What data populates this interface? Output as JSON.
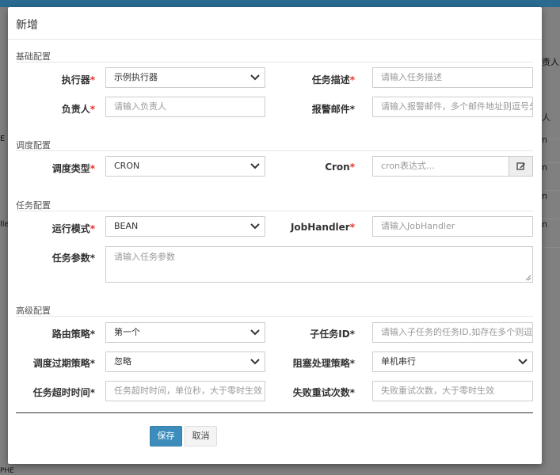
{
  "background": {
    "rows": [
      "人",
      "n",
      "n",
      "n",
      "n"
    ],
    "left_texts": [
      "E",
      "lle"
    ],
    "right_partial": "责人",
    "bottom_text": "PHE"
  },
  "modal": {
    "title": "新增",
    "sections": {
      "basic": "基础配置",
      "schedule": "调度配置",
      "task": "任务配置",
      "advanced": "高级配置"
    },
    "fields": {
      "executor": {
        "label": "执行器",
        "value": "示例执行器"
      },
      "task_desc": {
        "label": "任务描述",
        "placeholder": "请输入任务描述"
      },
      "owner": {
        "label": "负责人",
        "placeholder": "请输入负责人"
      },
      "alarm_email": {
        "label": "报警邮件",
        "placeholder": "请输入报警邮件，多个邮件地址则逗号分隔"
      },
      "schedule_type": {
        "label": "调度类型",
        "value": "CRON"
      },
      "cron": {
        "label": "Cron",
        "placeholder": "cron表达式..."
      },
      "run_mode": {
        "label": "运行模式",
        "value": "BEAN"
      },
      "job_handler": {
        "label": "JobHandler",
        "placeholder": "请输入JobHandler"
      },
      "task_param": {
        "label": "任务参数",
        "placeholder": "请输入任务参数"
      },
      "route_strategy": {
        "label": "路由策略",
        "value": "第一个"
      },
      "child_job": {
        "label": "子任务ID",
        "placeholder": "请输入子任务的任务ID,如存在多个则逗号分隔"
      },
      "misfire_strategy": {
        "label": "调度过期策略",
        "value": "忽略"
      },
      "block_strategy": {
        "label": "阻塞处理策略",
        "value": "单机串行"
      },
      "timeout": {
        "label": "任务超时时间",
        "placeholder": "任务超时时间，单位秒，大于零时生效"
      },
      "fail_retry": {
        "label": "失败重试次数",
        "placeholder": "失败重试次数，大于零时生效"
      }
    },
    "buttons": {
      "save": "保存",
      "cancel": "取消"
    },
    "required_mark": "*"
  },
  "colors": {
    "primary": "#3c8dbc",
    "required": "#e0332c",
    "header": "#2b6b92"
  },
  "icons": {
    "select_arrow": "chevron-down-icon",
    "cron_edit": "edit-icon"
  }
}
